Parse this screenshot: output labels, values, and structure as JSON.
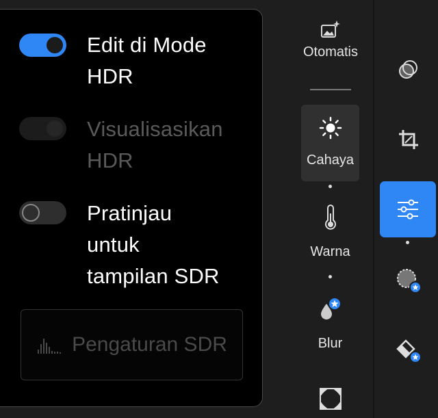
{
  "hdr_panel": {
    "options": [
      {
        "label_line1": "Edit di Mode",
        "label_line2": "HDR",
        "label_line3": "",
        "state": "on"
      },
      {
        "label_line1": "Visualisasikan",
        "label_line2": "HDR",
        "label_line3": "",
        "state": "disabled"
      },
      {
        "label_line1": "Pratinjau",
        "label_line2": "untuk",
        "label_line3": "tampilan SDR",
        "state": "off"
      }
    ],
    "sdr_settings_label": "Pengaturan SDR"
  },
  "edit_tools": [
    {
      "label": "Otomatis",
      "icon": "auto-image-sparkle-icon"
    },
    {
      "label": "Cahaya",
      "icon": "sun-icon",
      "selected": true
    },
    {
      "label": "Warna",
      "icon": "thermometer-icon"
    },
    {
      "label": "Blur",
      "icon": "lens-blur-drop-icon",
      "premium": true
    },
    {
      "label": "",
      "icon": "vignette-frame-icon"
    }
  ],
  "side_tools": [
    {
      "icon": "presets-icon"
    },
    {
      "icon": "crop-icon"
    },
    {
      "icon": "adjust-sliders-icon",
      "selected": true
    },
    {
      "icon": "masking-icon",
      "premium": true
    },
    {
      "icon": "healing-eraser-icon",
      "premium": true
    }
  ],
  "colors": {
    "accent": "#2f86f5",
    "panel_bg": "#000000",
    "toolbar_bg": "#1e1e1e"
  }
}
